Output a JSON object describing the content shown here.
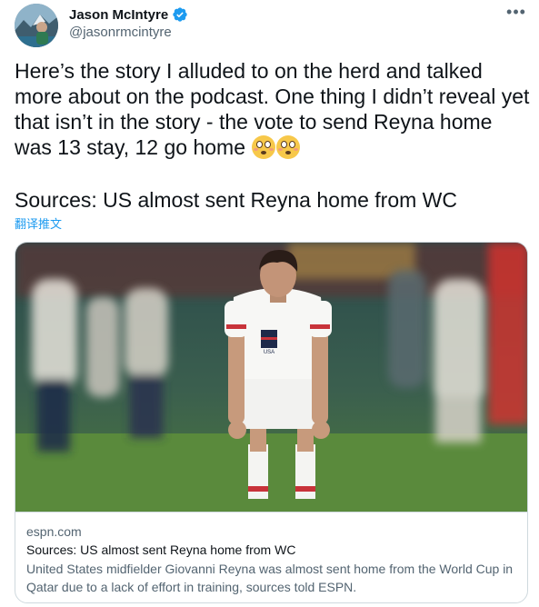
{
  "author": {
    "display_name": "Jason McIntyre",
    "handle": "@jasonrmcintyre",
    "verified": true
  },
  "menu_icon": "more-horizontal-icon",
  "tweet": {
    "text": "Here’s the story I alluded to on the herd and talked more about on the podcast. One thing I didn’t reveal yet that isn’t in the story - the vote to send Reyna home was 13 stay, 12 go home",
    "emojis": [
      "flushed-face-icon",
      "flushed-face-icon"
    ],
    "headline": "Sources: US almost sent Reyna home from WC",
    "translate_label": "翻译推文"
  },
  "card": {
    "domain": "espn.com",
    "title": "Sources: US almost sent Reyna home from WC",
    "description": "United States midfielder Giovanni Reyna was almost sent home from the World Cup in Qatar due to a lack of effort in training, sources told ESPN.",
    "image": "soccer-player-photo",
    "jersey_text": "USA"
  },
  "colors": {
    "link": "#1d9bf0",
    "secondary_text": "#536471",
    "verified_badge": "#1d9bf0",
    "border": "#cfd9de"
  }
}
